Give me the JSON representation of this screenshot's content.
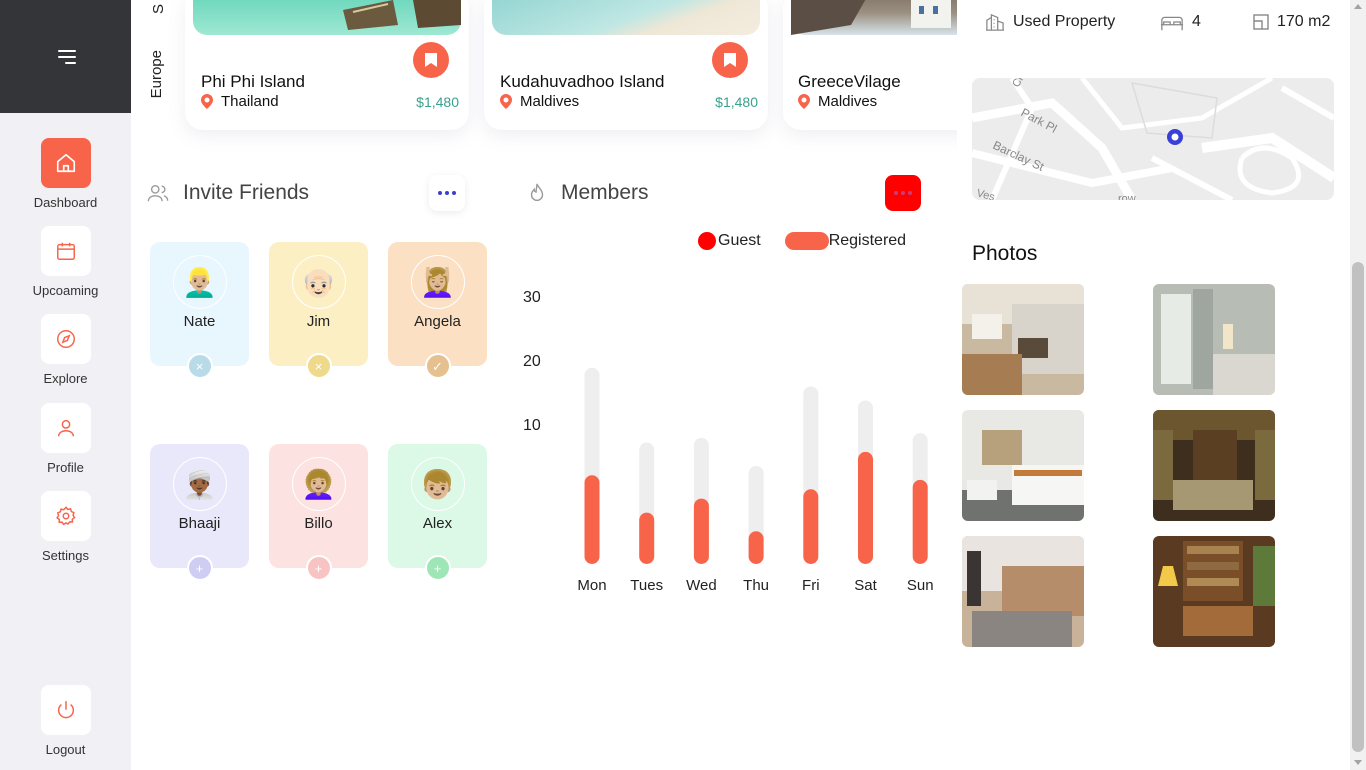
{
  "sidebar": {
    "items": [
      {
        "label": "Dashboard",
        "icon": "home-icon",
        "active": true
      },
      {
        "label": "Upcoaming",
        "icon": "calendar-icon",
        "active": false
      },
      {
        "label": "Explore",
        "icon": "compass-icon",
        "active": false
      },
      {
        "label": "Profile",
        "icon": "user-icon",
        "active": false
      },
      {
        "label": "Settings",
        "icon": "gear-icon",
        "active": false
      }
    ],
    "logout": {
      "label": "Logout",
      "icon": "power-icon"
    }
  },
  "destinations": {
    "region_label": "Europe",
    "cut_label": "S",
    "cards": [
      {
        "name": "Phi Phi Island",
        "location": "Thailand",
        "price": "$1,480"
      },
      {
        "name": "Kudahuvadhoo Island",
        "location": "Maldives",
        "price": "$1,480"
      },
      {
        "name": "GreeceVilage",
        "location": "Maldives",
        "price": ""
      }
    ]
  },
  "invite": {
    "title": "Invite Friends",
    "friends": [
      {
        "name": "Nate",
        "emoji": "👱🏼‍♂️",
        "bg": "#e8f6fd",
        "action": "×",
        "action_bg": "#b9dbe8"
      },
      {
        "name": "Jim",
        "emoji": "👴🏻",
        "bg": "#fdefc4",
        "action": "×",
        "action_bg": "#efd98a"
      },
      {
        "name": "Angela",
        "emoji": "💆🏼‍♀️",
        "bg": "#fbe0c3",
        "action": "✓",
        "action_bg": "#e6c08e"
      },
      {
        "name": "Bhaaji",
        "emoji": "👳🏾‍♂️",
        "bg": "#e9e8fb",
        "action": "+",
        "action_bg": "#cfcdf3"
      },
      {
        "name": "Billo",
        "emoji": "👩🏼‍🦱",
        "bg": "#fde2e2",
        "action": "+",
        "action_bg": "#f8c3c3"
      },
      {
        "name": "Alex",
        "emoji": "👦🏼",
        "bg": "#dcf8e6",
        "action": "+",
        "action_bg": "#9fe6b7"
      }
    ]
  },
  "members": {
    "title": "Members",
    "legend": {
      "guest": "Guest",
      "registered": "Registered"
    }
  },
  "chart_data": {
    "type": "bar",
    "categories": [
      "Mon",
      "Tues",
      "Wed",
      "Thu",
      "Fri",
      "Sat",
      "Sun"
    ],
    "series": [
      {
        "name": "Guest",
        "values": [
          42,
          26,
          27,
          21,
          38,
          35,
          28
        ]
      },
      {
        "name": "Registered",
        "values": [
          19,
          11,
          14,
          7,
          16,
          24,
          18
        ]
      }
    ],
    "yticks": [
      10,
      20,
      30,
      40
    ],
    "ylim": [
      0,
      40
    ],
    "colors": {
      "guest": "#eeeeee",
      "registered": "#f8644a"
    }
  },
  "property": {
    "type_label": "Used Property",
    "beds": "4",
    "area": "170 m2"
  },
  "map": {
    "streets": [
      "Park Pl",
      "Barclay St",
      "Ch",
      "Ves",
      "row"
    ]
  },
  "photos": {
    "title": "Photos",
    "items": [
      "kitchen",
      "bedroom",
      "dining-kitchen",
      "antique-living-room",
      "modern-bedroom",
      "library-lounge"
    ]
  },
  "colors": {
    "accent": "#f8644a",
    "sidebar_dark": "#333539",
    "price": "#3aa18f"
  }
}
